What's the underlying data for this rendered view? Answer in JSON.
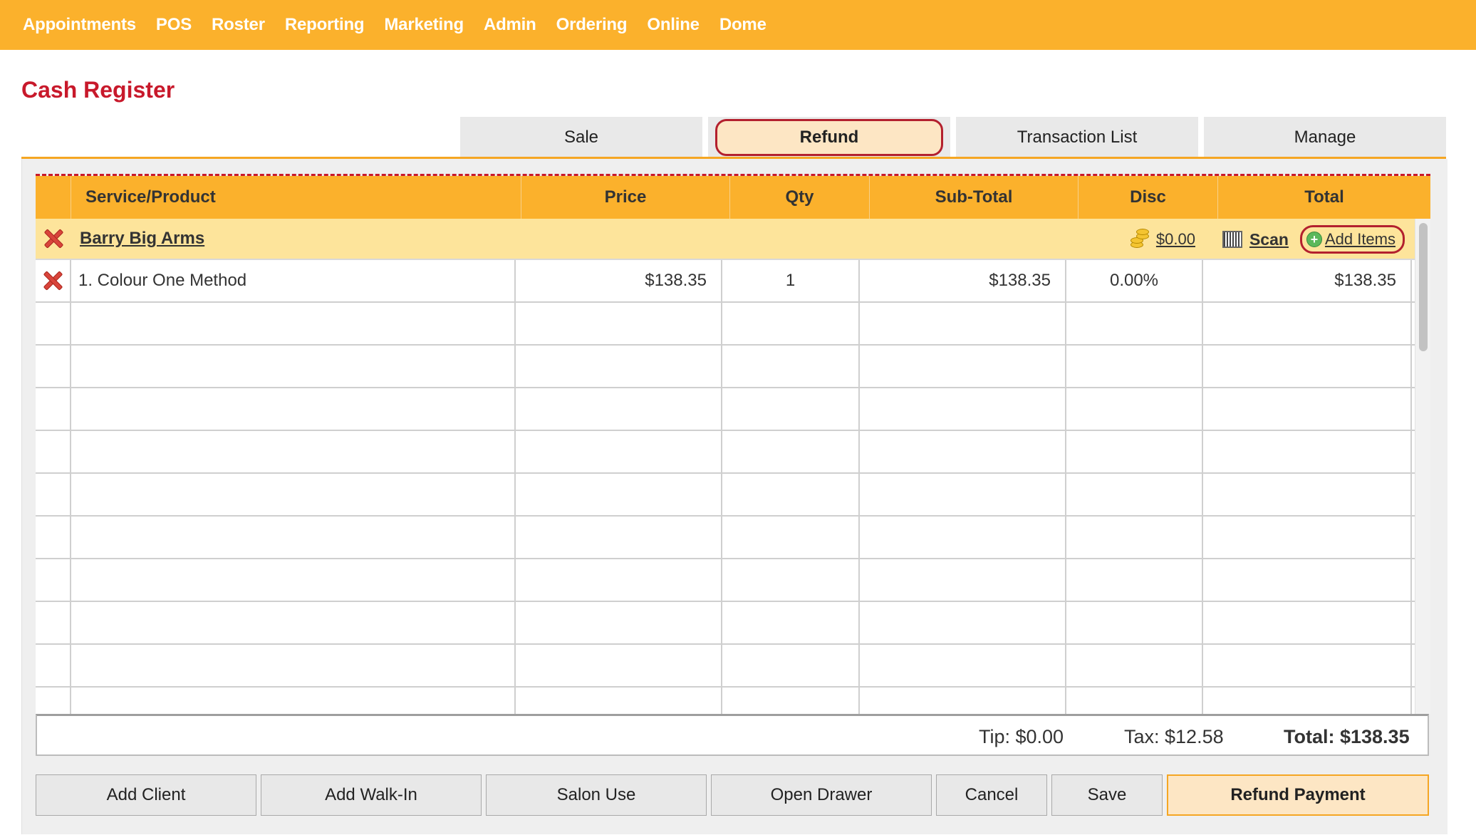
{
  "nav": {
    "items": [
      "Appointments",
      "POS",
      "Roster",
      "Reporting",
      "Marketing",
      "Admin",
      "Ordering",
      "Online",
      "Dome"
    ]
  },
  "page": {
    "title": "Cash Register"
  },
  "tabs": [
    {
      "label": "Sale",
      "active": false
    },
    {
      "label": "Refund",
      "active": true
    },
    {
      "label": "Transaction List",
      "active": false
    },
    {
      "label": "Manage",
      "active": false
    }
  ],
  "table": {
    "headers": [
      "Service/Product",
      "Price",
      "Qty",
      "Sub-Total",
      "Disc",
      "Total"
    ],
    "client": {
      "name": "Barry Big Arms",
      "credit": "$0.00",
      "scan_label": "Scan",
      "add_items_label": "Add Items"
    },
    "rows": [
      {
        "item": "1. Colour One Method",
        "price": "$138.35",
        "qty": "1",
        "subtotal": "$138.35",
        "disc": "0.00%",
        "total": "$138.35"
      }
    ]
  },
  "totals": {
    "tip": "Tip: $0.00",
    "tax": "Tax: $12.58",
    "total": "Total: $138.35"
  },
  "buttons": {
    "add_client": "Add Client",
    "add_walkin": "Add Walk-In",
    "salon_use": "Salon Use",
    "open_drawer": "Open Drawer",
    "cancel": "Cancel",
    "save": "Save",
    "refund_payment": "Refund Payment"
  },
  "colors": {
    "nav_bg": "#fbb12c",
    "title_red": "#c8192b",
    "active_tab_border": "#b3202e",
    "client_row_bg": "#fde49b"
  }
}
